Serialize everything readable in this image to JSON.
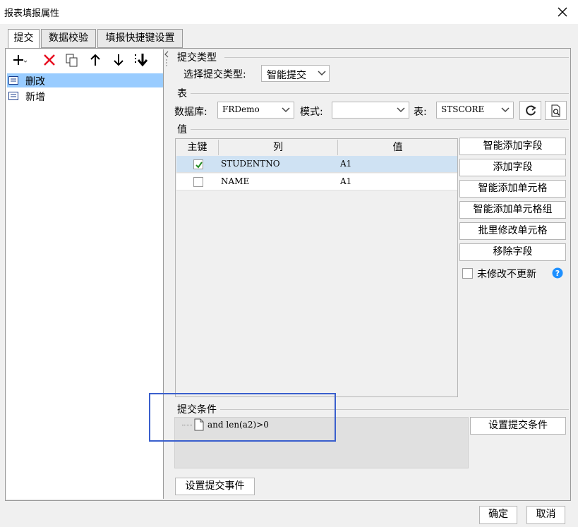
{
  "window": {
    "title": "报表填报属性"
  },
  "tabs": [
    {
      "label": "提交",
      "active": true
    },
    {
      "label": "数据校验",
      "active": false
    },
    {
      "label": "填报快捷键设置",
      "active": false
    }
  ],
  "toolbar": {
    "icons": [
      "add-icon",
      "delete-icon",
      "copy-icon",
      "move-up-icon",
      "move-down-icon",
      "move-bottom-icon"
    ]
  },
  "tree": {
    "items": [
      {
        "label": "删改",
        "selected": true
      },
      {
        "label": "新增",
        "selected": false
      }
    ]
  },
  "submit_type": {
    "section_label": "提交类型",
    "label": "选择提交类型:",
    "value": "智能提交"
  },
  "table_section": {
    "section_label": "表",
    "db_label": "数据库:",
    "db_value": "FRDemo",
    "mode_label": "模式:",
    "mode_value": "",
    "table_label": "表:",
    "table_value": "STSCORE"
  },
  "values": {
    "section_label": "值",
    "columns": [
      "主键",
      "列",
      "值"
    ],
    "rows": [
      {
        "key": true,
        "column": "STUDENTNO",
        "value": "A1"
      },
      {
        "key": false,
        "column": "NAME",
        "value": "A1"
      }
    ]
  },
  "side_buttons": [
    "智能添加字段",
    "添加字段",
    "智能添加单元格",
    "智能添加单元格组",
    "批里修改单元格",
    "移除字段"
  ],
  "no_update": {
    "label": "未修改不更新",
    "checked": false
  },
  "condition": {
    "section_label": "提交条件",
    "text": "and len(a2)>0",
    "button": "设置提交条件"
  },
  "event_button": "设置提交事件",
  "footer": {
    "ok": "确定",
    "cancel": "取消"
  },
  "colors": {
    "selection": "#99ccff",
    "row_selection": "#cfe2f3",
    "highlight_box": "#3a5fcd",
    "delete": "#e81123",
    "help": "#1e90ff"
  }
}
